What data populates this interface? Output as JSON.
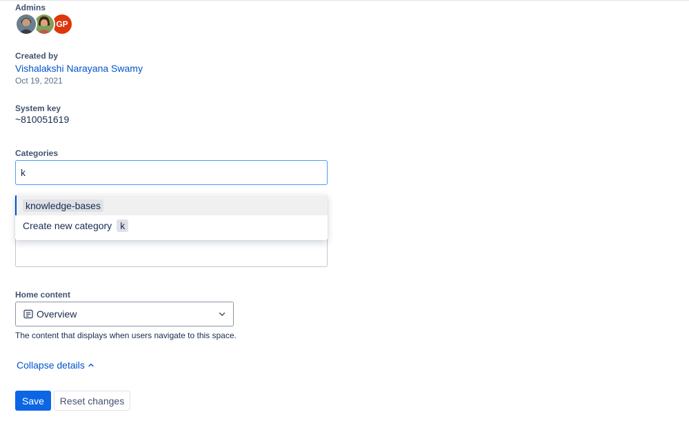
{
  "admins": {
    "label": "Admins",
    "avatars": [
      {
        "type": "photo",
        "name": "avatar-1"
      },
      {
        "type": "photo",
        "name": "avatar-2"
      },
      {
        "type": "initials",
        "initials": "GP",
        "color": "#de350b"
      }
    ]
  },
  "created_by": {
    "label": "Created by",
    "name": "Vishalakshi Narayana Swamy",
    "date": "Oct 19, 2021"
  },
  "system_key": {
    "label": "System key",
    "value": "~810051619"
  },
  "categories": {
    "label": "Categories",
    "input_value": "k",
    "dropdown": {
      "option_1": "knowledge-bases",
      "create_label": "Create new category",
      "create_query": "k"
    }
  },
  "home_content": {
    "label": "Home content",
    "selected": "Overview",
    "icon": "page-icon",
    "helper": "The content that displays when users navigate to this space."
  },
  "collapse_label": "Collapse details",
  "buttons": {
    "save": "Save",
    "reset": "Reset changes"
  },
  "colors": {
    "link": "#0052cc",
    "primary_button": "#0c66e4",
    "focus_border": "#4c9aff",
    "avatar_initials_bg": "#de350b"
  }
}
